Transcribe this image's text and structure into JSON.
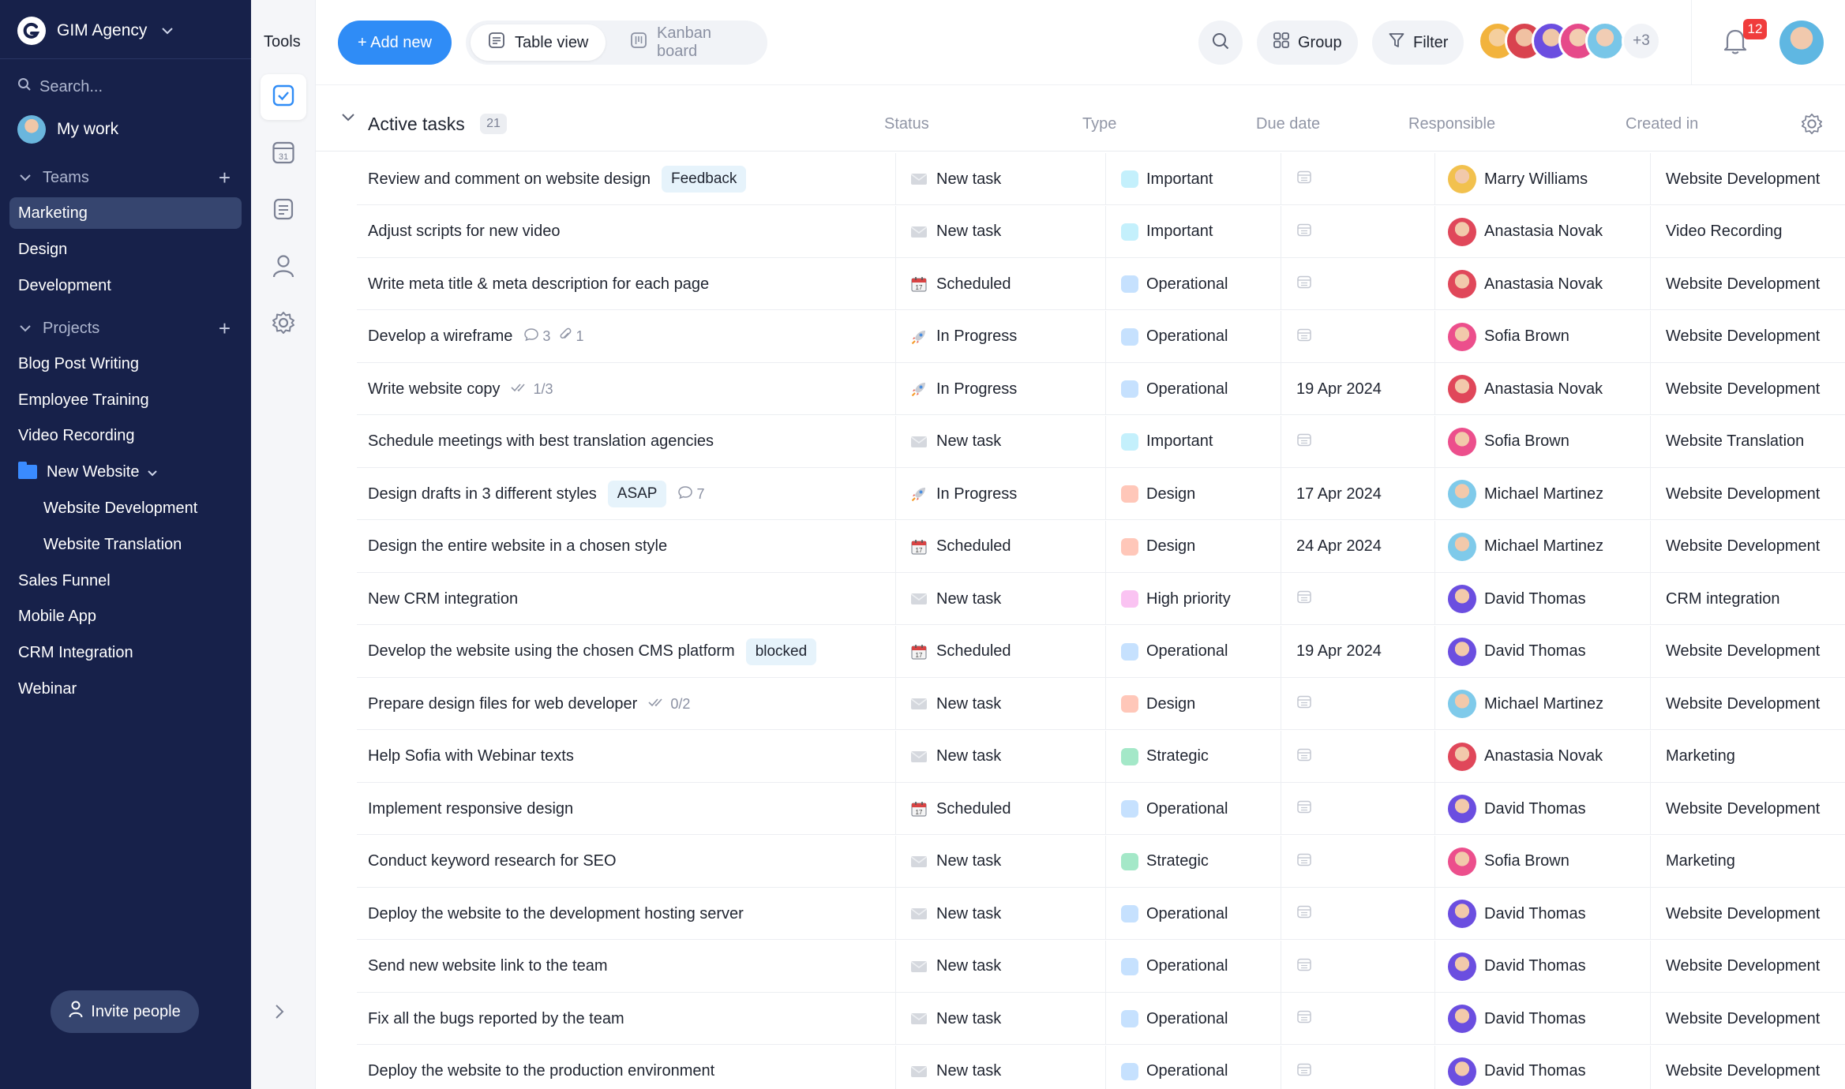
{
  "sidebar": {
    "org_name": "GIM Agency",
    "search_placeholder": "Search...",
    "my_work": "My work",
    "teams_label": "Teams",
    "teams": [
      "Marketing",
      "Design",
      "Development"
    ],
    "projects_label": "Projects",
    "projects": [
      "Blog Post Writing",
      "Employee Training",
      "Video Recording"
    ],
    "folder": "New Website",
    "folder_children": [
      "Website Development",
      "Website Translation"
    ],
    "projects_more": [
      "Sales Funnel",
      "Mobile App",
      "CRM Integration",
      "Webinar"
    ],
    "invite_label": "Invite people",
    "colors": {
      "background": "#17214a",
      "active_item": "#36456f",
      "folder": "#3a8bff"
    }
  },
  "tools": {
    "title": "Tools",
    "items": [
      "tasks-icon",
      "calendar-icon",
      "notes-icon",
      "people-icon",
      "gear-icon"
    ],
    "calendar_day": "31"
  },
  "topbar": {
    "add_label": "+ Add new",
    "views": [
      {
        "label": "Table view",
        "active": true
      },
      {
        "label": "Kanban board",
        "active": false
      }
    ],
    "group_label": "Group",
    "filter_label": "Filter",
    "more_members": "+3",
    "notifications": "12",
    "accent": "#2f8cf6"
  },
  "table": {
    "group_title": "Active tasks",
    "group_count": "21",
    "columns": {
      "status": "Status",
      "type": "Type",
      "due": "Due date",
      "responsible": "Responsible",
      "created": "Created in"
    },
    "rows": [
      {
        "title": "Review and comment on website design",
        "tag": "Feedback",
        "comments": "",
        "attachments": "",
        "checklist": "",
        "status": "New task",
        "type": "Important",
        "due": "",
        "responsible": "Marry Williams",
        "created": "Website Development"
      },
      {
        "title": "Adjust scripts for new video",
        "tag": "",
        "comments": "",
        "attachments": "",
        "checklist": "",
        "status": "New task",
        "type": "Important",
        "due": "",
        "responsible": "Anastasia Novak",
        "created": "Video Recording"
      },
      {
        "title": "Write meta title & meta description for each page",
        "tag": "",
        "comments": "",
        "attachments": "",
        "checklist": "",
        "status": "Scheduled",
        "type": "Operational",
        "due": "",
        "responsible": "Anastasia Novak",
        "created": "Website Development"
      },
      {
        "title": "Develop a wireframe",
        "tag": "",
        "comments": "3",
        "attachments": "1",
        "checklist": "",
        "status": "In Progress",
        "type": "Operational",
        "due": "",
        "responsible": "Sofia Brown",
        "created": "Website Development"
      },
      {
        "title": "Write website copy",
        "tag": "",
        "comments": "",
        "attachments": "",
        "checklist": "1/3",
        "status": "In Progress",
        "type": "Operational",
        "due": "19 Apr 2024",
        "responsible": "Anastasia Novak",
        "created": "Website Development"
      },
      {
        "title": "Schedule meetings with best translation agencies",
        "tag": "",
        "comments": "",
        "attachments": "",
        "checklist": "",
        "status": "New task",
        "type": "Important",
        "due": "",
        "responsible": "Sofia Brown",
        "created": "Website Translation"
      },
      {
        "title": "Design drafts in 3 different styles",
        "tag": "ASAP",
        "comments": "7",
        "attachments": "",
        "checklist": "",
        "status": "In Progress",
        "type": "Design",
        "due": "17 Apr 2024",
        "responsible": "Michael Martinez",
        "created": "Website Development"
      },
      {
        "title": "Design the entire website in a chosen style",
        "tag": "",
        "comments": "",
        "attachments": "",
        "checklist": "",
        "status": "Scheduled",
        "type": "Design",
        "due": "24 Apr 2024",
        "responsible": "Michael Martinez",
        "created": "Website Development"
      },
      {
        "title": "New CRM integration",
        "tag": "",
        "comments": "",
        "attachments": "",
        "checklist": "",
        "status": "New task",
        "type": "High priority",
        "due": "",
        "responsible": "David Thomas",
        "created": "CRM integration"
      },
      {
        "title": "Develop the website using the chosen CMS platform",
        "tag": "blocked",
        "comments": "",
        "attachments": "",
        "checklist": "",
        "status": "Scheduled",
        "type": "Operational",
        "due": "19 Apr 2024",
        "responsible": "David Thomas",
        "created": "Website Development"
      },
      {
        "title": "Prepare design files for web developer",
        "tag": "",
        "comments": "",
        "attachments": "",
        "checklist": "0/2",
        "status": "New task",
        "type": "Design",
        "due": "",
        "responsible": "Michael Martinez",
        "created": "Website Development"
      },
      {
        "title": "Help Sofia with Webinar texts",
        "tag": "",
        "comments": "",
        "attachments": "",
        "checklist": "",
        "status": "New task",
        "type": "Strategic",
        "due": "",
        "responsible": "Anastasia Novak",
        "created": "Marketing"
      },
      {
        "title": "Implement responsive design",
        "tag": "",
        "comments": "",
        "attachments": "",
        "checklist": "",
        "status": "Scheduled",
        "type": "Operational",
        "due": "",
        "responsible": "David Thomas",
        "created": "Website Development"
      },
      {
        "title": "Conduct keyword research for SEO",
        "tag": "",
        "comments": "",
        "attachments": "",
        "checklist": "",
        "status": "New task",
        "type": "Strategic",
        "due": "",
        "responsible": "Sofia Brown",
        "created": "Marketing"
      },
      {
        "title": "Deploy the website to the development hosting server",
        "tag": "",
        "comments": "",
        "attachments": "",
        "checklist": "",
        "status": "New task",
        "type": "Operational",
        "due": "",
        "responsible": "David Thomas",
        "created": "Website Development"
      },
      {
        "title": "Send new website link to the team",
        "tag": "",
        "comments": "",
        "attachments": "",
        "checklist": "",
        "status": "New task",
        "type": "Operational",
        "due": "",
        "responsible": "David Thomas",
        "created": "Website Development"
      },
      {
        "title": "Fix all the bugs reported by the team",
        "tag": "",
        "comments": "",
        "attachments": "",
        "checklist": "",
        "status": "New task",
        "type": "Operational",
        "due": "",
        "responsible": "David Thomas",
        "created": "Website Development"
      },
      {
        "title": "Deploy the website to the production environment",
        "tag": "",
        "comments": "",
        "attachments": "",
        "checklist": "",
        "status": "New task",
        "type": "Operational",
        "due": "",
        "responsible": "David Thomas",
        "created": "Website Development"
      }
    ],
    "type_colors": {
      "Important": "#c7effa",
      "Operational": "#c8e1fb",
      "Design": "#fcc8bb",
      "High priority": "#f6c4ef",
      "Strategic": "#a9e6c9"
    },
    "person_colors": {
      "Marry Williams": "#f2c14e",
      "Anastasia Novak": "#e0475a",
      "Sofia Brown": "#ec4f8c",
      "Michael Martinez": "#7fcaea",
      "David Thomas": "#6b4ee0"
    }
  }
}
